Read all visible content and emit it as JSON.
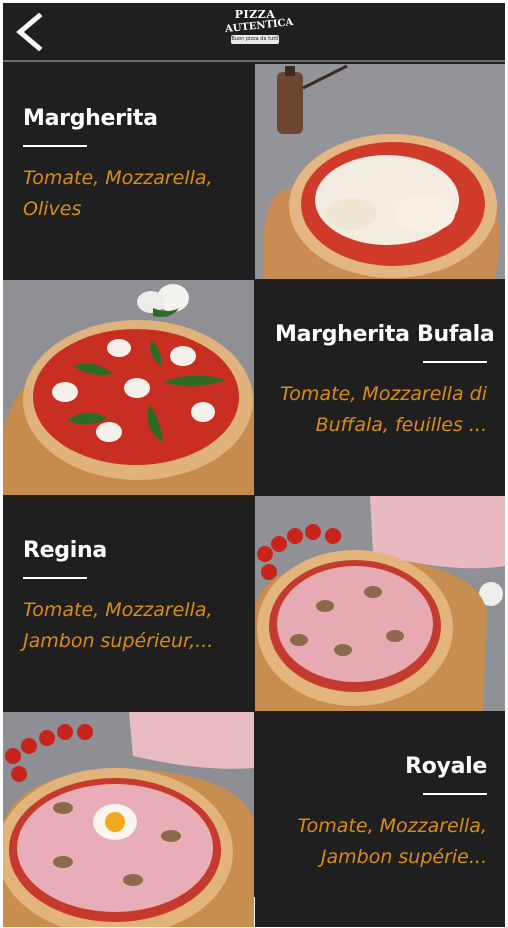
{
  "header": {
    "back_icon": "chevron-left-icon",
    "logo": {
      "line1": "PIZZA",
      "line2": "AUTENTICA",
      "tagline": "Buon pizza da tutti"
    }
  },
  "colors": {
    "background": "#1f1f1f",
    "name": "#ffffff",
    "ingredients": "#d98c1a"
  },
  "pizzas": [
    {
      "name": "Margherita",
      "ingredients": "Tomate, Mozzarella, Olives"
    },
    {
      "name": "Margherita Bufala",
      "ingredients": "Tomate, Mozzarella di Buffala, feuilles ..."
    },
    {
      "name": "Regina",
      "ingredients": "Tomate, Mozzarella, Jambon supérieur,..."
    },
    {
      "name": "Royale",
      "ingredients": "Tomate, Mozzarella, Jambon supérie..."
    }
  ]
}
